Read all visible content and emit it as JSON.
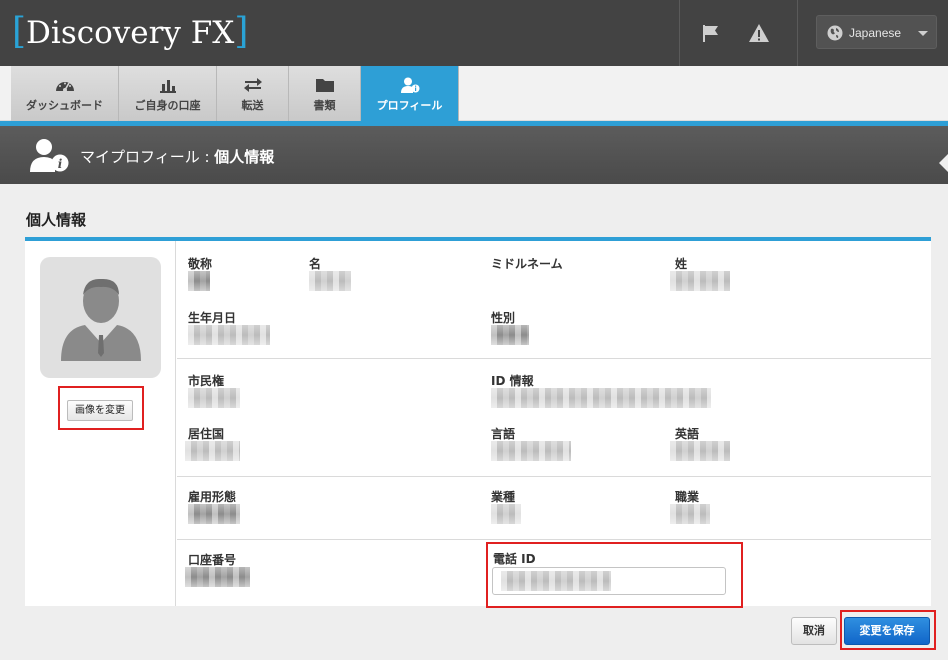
{
  "header": {
    "brand": "Discovery FX",
    "bracket_open": "[",
    "bracket_close": "]",
    "language": "Japanese",
    "accent_color": "#2e9fd6"
  },
  "tabs": [
    {
      "label": "ダッシュボード",
      "icon": "dashboard-icon"
    },
    {
      "label": "ご自身の口座",
      "icon": "bar-chart-icon"
    },
    {
      "label": "転送",
      "icon": "transfer-arrows-icon"
    },
    {
      "label": "書類",
      "icon": "folder-icon"
    },
    {
      "label": "プロフィール",
      "icon": "user-info-icon",
      "active": true
    }
  ],
  "band": {
    "title_prefix": "マイプロフィール : ",
    "title_bold": "個人情報"
  },
  "section": {
    "title": "個人情報"
  },
  "avatar": {
    "change_image_label": "画像を変更"
  },
  "fields": {
    "salutation": "敬称",
    "first_name": "名",
    "middle_name": "ミドルネーム",
    "last_name": "姓",
    "birth_date": "生年月日",
    "gender": "性別",
    "citizenship": "市民権",
    "id_info": "ID 情報",
    "country_of_residence": "居住国",
    "language": "言語",
    "english": "英語",
    "employment_status": "雇用形態",
    "industry": "業種",
    "occupation": "職業",
    "account_number": "口座番号",
    "phone_id": "電話 ID"
  },
  "actions": {
    "cancel": "取消",
    "save": "変更を保存"
  }
}
